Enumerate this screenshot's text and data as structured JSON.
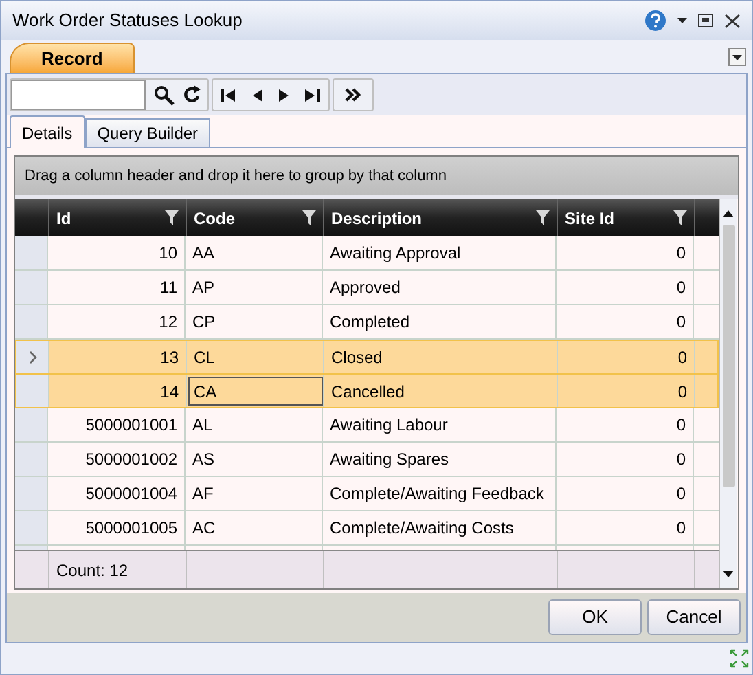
{
  "window": {
    "title": "Work Order Statuses Lookup"
  },
  "ribbon_tabs": [
    {
      "label": "Record",
      "selected": true
    }
  ],
  "tabs": [
    {
      "label": "Details",
      "selected": true
    },
    {
      "label": "Query Builder",
      "selected": false
    }
  ],
  "group_panel": {
    "text": "Drag a column header and drop it here to group by that column"
  },
  "table": {
    "columns": [
      {
        "label": "Id"
      },
      {
        "label": "Code"
      },
      {
        "label": "Description"
      },
      {
        "label": "Site Id"
      }
    ],
    "rows": [
      {
        "cells": [
          "10",
          "AA",
          "Awaiting Approval",
          "0"
        ],
        "selected": false,
        "current": false,
        "focused": false
      },
      {
        "cells": [
          "11",
          "AP",
          "Approved",
          "0"
        ],
        "selected": false,
        "current": false,
        "focused": false
      },
      {
        "cells": [
          "12",
          "CP",
          "Completed",
          "0"
        ],
        "selected": false,
        "current": false,
        "focused": false
      },
      {
        "cells": [
          "13",
          "CL",
          "Closed",
          "0"
        ],
        "selected": true,
        "current": true,
        "focused": false
      },
      {
        "cells": [
          "14",
          "CA",
          "Cancelled",
          "0"
        ],
        "selected": true,
        "current": false,
        "focused": true
      },
      {
        "cells": [
          "5000001001",
          "AL",
          "Awaiting Labour",
          "0"
        ],
        "selected": false,
        "current": false,
        "focused": false
      },
      {
        "cells": [
          "5000001002",
          "AS",
          "Awaiting Spares",
          "0"
        ],
        "selected": false,
        "current": false,
        "focused": false
      },
      {
        "cells": [
          "5000001004",
          "AF",
          "Complete/Awaiting Feedback",
          "0"
        ],
        "selected": false,
        "current": false,
        "focused": false
      },
      {
        "cells": [
          "5000001005",
          "AC",
          "Complete/Awaiting Costs",
          "0"
        ],
        "selected": false,
        "current": false,
        "focused": false
      }
    ],
    "footer": "Count: 12"
  },
  "buttons": [
    "OK",
    "Cancel"
  ]
}
